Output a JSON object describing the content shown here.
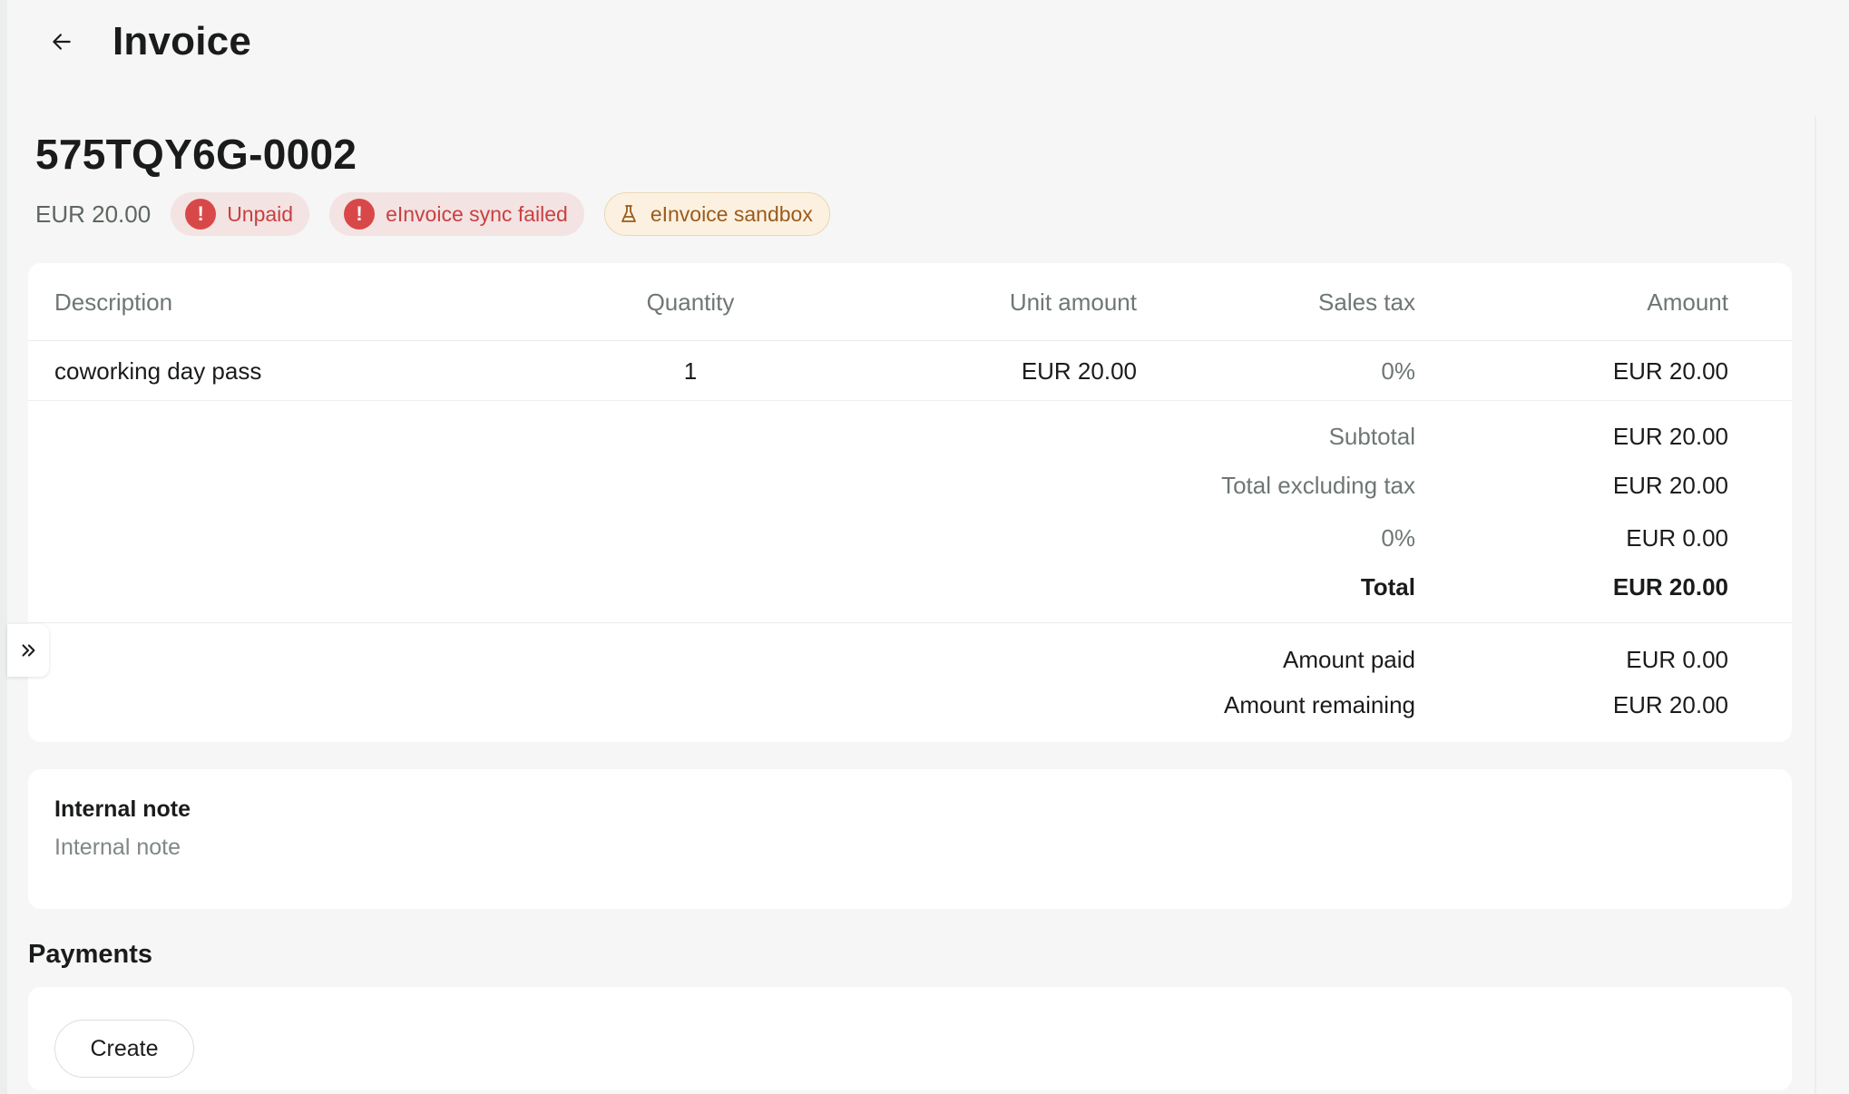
{
  "header": {
    "title": "Invoice"
  },
  "invoice": {
    "id": "575TQY6G-0002",
    "amount": "EUR 20.00",
    "badges": [
      {
        "label": "Unpaid",
        "icon": "exclamation-icon"
      },
      {
        "label": "eInvoice sync failed",
        "icon": "exclamation-icon"
      },
      {
        "label": "eInvoice sandbox",
        "icon": "flask-icon"
      }
    ]
  },
  "table": {
    "columns": [
      "Description",
      "Quantity",
      "Unit amount",
      "Sales tax",
      "Amount"
    ],
    "rows": [
      {
        "description": "coworking day pass",
        "quantity": "1",
        "unit_amount": "EUR 20.00",
        "sales_tax": "0%",
        "amount": "EUR 20.00"
      }
    ]
  },
  "totals": {
    "subtotal_label": "Subtotal",
    "subtotal": "EUR 20.00",
    "excl_tax_label": "Total excluding tax",
    "excl_tax": "EUR 20.00",
    "tax_label": "0%",
    "tax": "EUR 0.00",
    "total_label": "Total",
    "total": "EUR 20.00"
  },
  "payment_summary": {
    "paid_label": "Amount paid",
    "paid": "EUR 0.00",
    "remaining_label": "Amount remaining",
    "remaining": "EUR 20.00"
  },
  "internal_note": {
    "title": "Internal note",
    "placeholder": "Internal note"
  },
  "payments": {
    "title": "Payments",
    "create_label": "Create"
  },
  "colors": {
    "danger": "#d94848",
    "danger_bg": "#f3e3e3",
    "warning_bg": "#fcf1e0",
    "warning_text": "#9a5b1c"
  }
}
